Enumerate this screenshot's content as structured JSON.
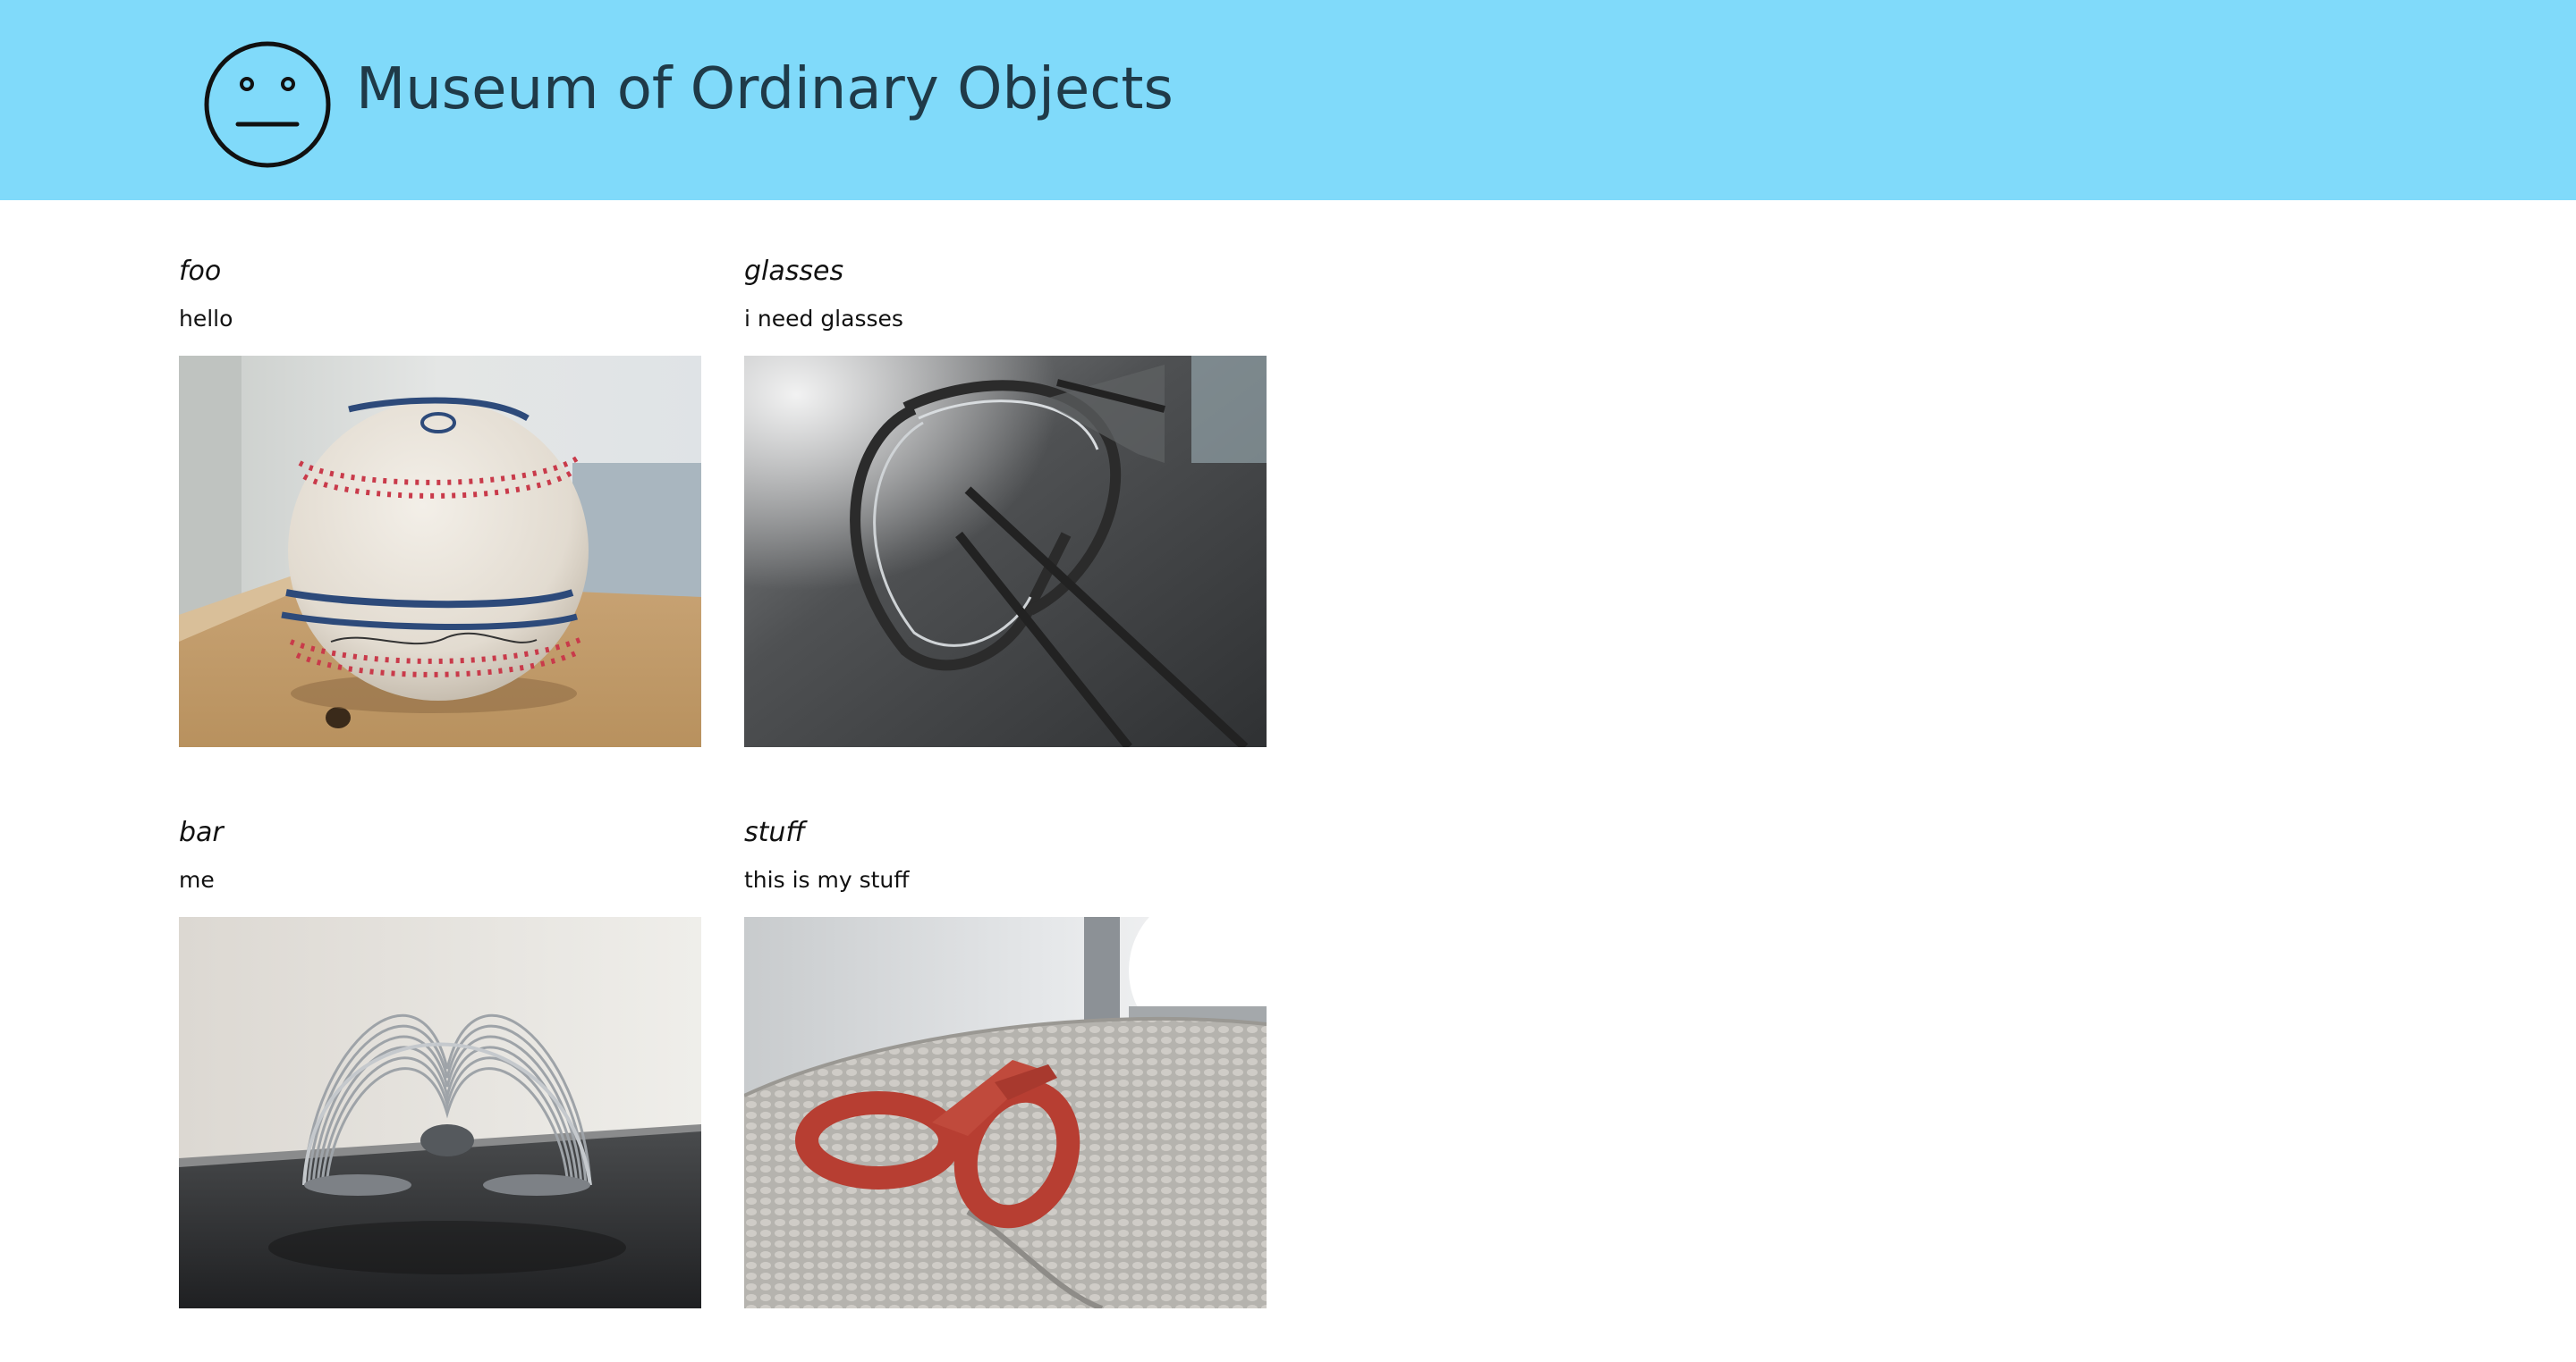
{
  "header": {
    "title": "Museum of Ordinary Objects",
    "logo_icon": "neutral-face-icon",
    "background_color": "#80dafa"
  },
  "items": [
    {
      "title": "foo",
      "description": "hello",
      "image_icon": "baseball-photo"
    },
    {
      "title": "glasses",
      "description": "i need glasses",
      "image_icon": "eyeglasses-photo"
    },
    {
      "title": "bar",
      "description": "me",
      "image_icon": "slinky-photo"
    },
    {
      "title": "stuff",
      "description": "this is my stuff",
      "image_icon": "scissors-photo"
    }
  ]
}
